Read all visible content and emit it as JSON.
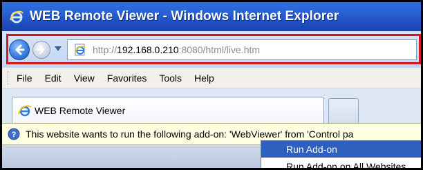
{
  "window": {
    "title": "WEB Remote Viewer - Windows Internet Explorer"
  },
  "address_bar": {
    "url_prefix": "http://",
    "url_host": "192.168.0.210",
    "url_suffix": ":8080/html/live.htm"
  },
  "menu": {
    "items": [
      "File",
      "Edit",
      "View",
      "Favorites",
      "Tools",
      "Help"
    ]
  },
  "tabs": {
    "active_label": "WEB Remote Viewer"
  },
  "infobar": {
    "text": "This website wants to run the following add-on: 'WebViewer' from 'Control pa"
  },
  "context_menu": {
    "items": [
      "Run Add-on",
      "Run Add-on on All Websites"
    ]
  },
  "colors": {
    "titlebar": "#2a62d6",
    "highlight_border": "#d21a1a",
    "menu_selection": "#2f5fbf",
    "infobar_bg": "#ffffe1"
  }
}
